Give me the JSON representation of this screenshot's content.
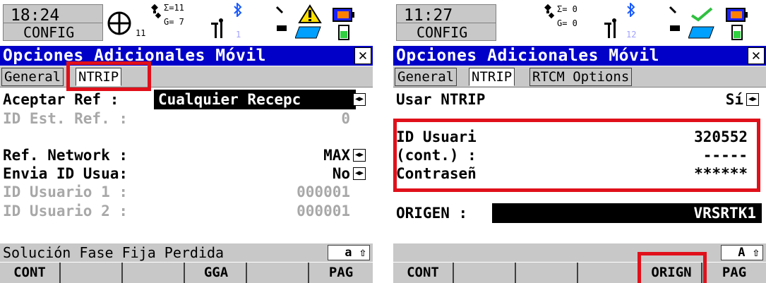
{
  "left": {
    "status": {
      "time": "18:24",
      "mode": "CONFIG",
      "sat_count_label": "11",
      "sum_label": "Σ=11",
      "g_label": "G= 7",
      "line_number": "1"
    },
    "title": "Opciones Adicionales Móvil",
    "tabs": [
      "General",
      "NTRIP"
    ],
    "fields": [
      {
        "label": "Aceptar Ref   :",
        "value": "Cualquier Recepc"
      },
      {
        "label": "ID Est. Ref. :",
        "value": "0"
      },
      {
        "label": "Ref. Network :",
        "value": "MAX"
      },
      {
        "label": "Envia ID Usua:",
        "value": "No"
      },
      {
        "label": "ID Usuario 1 :",
        "value": "000001"
      },
      {
        "label": "ID Usuario 2 :",
        "value": "000001"
      }
    ],
    "message": "Solución Fase Fija Perdida",
    "keyboard_mode": "a ⇧",
    "fkeys": [
      "CONT",
      "",
      "",
      "GGA",
      "",
      "PAG"
    ]
  },
  "right": {
    "status": {
      "time": "11:27",
      "mode": "CONFIG",
      "sum_label": "Σ= 0",
      "g_label": "G= 0",
      "line_number": "12"
    },
    "title": "Opciones Adicionales Móvil",
    "tabs": [
      "General",
      "NTRIP",
      "RTCM Options"
    ],
    "fields": [
      {
        "label": "Usar NTRIP",
        "value": "Sí"
      },
      {
        "label": "ID Usuari",
        "value": "320552"
      },
      {
        "label": "(cont.) :",
        "value": "-----"
      },
      {
        "label": "Contraseñ",
        "value": "******"
      },
      {
        "label": "ORIGEN    :",
        "value": "VRSRTK1"
      }
    ],
    "message": "",
    "keyboard_mode": "A ⇧",
    "fkeys": [
      "CONT",
      "",
      "",
      "",
      "ORIGN",
      "PAG"
    ]
  },
  "icons": {
    "close": "close-icon",
    "arrows": "left-right-arrows-icon",
    "satellite": "satellite-icon",
    "position": "crosshair-icon",
    "bluetooth": "bluetooth-icon",
    "battery": "battery-icon"
  },
  "colors": {
    "titlebar": "#0000c8",
    "highlight": "#e0101a",
    "bar": "#c8c8c8"
  }
}
